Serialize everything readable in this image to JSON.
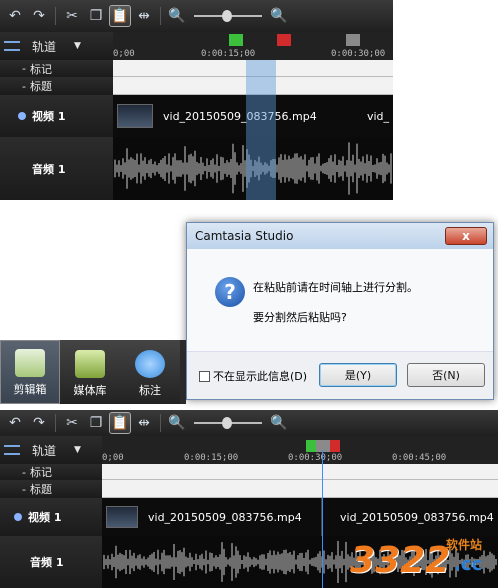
{
  "colors": {
    "marker_green": "#3cbf3c",
    "marker_red": "#d22b2b",
    "marker_gray": "#8a8a8a",
    "playhead": "#3d8bff",
    "selection": "#5b9ad8"
  },
  "top": {
    "tooltip": "粘贴",
    "tracks_label": "轨道",
    "ruler_ticks": [
      "0;00",
      "0:00:15;00",
      "0:00:30;00"
    ],
    "rows": {
      "marker": "标记",
      "title": "标题"
    },
    "video_track": "视频 1",
    "audio_track": "音频 1",
    "clip_name": "vid_20150509_083756.mp4",
    "clip_name_cut": "vid_"
  },
  "dialog": {
    "title": "Camtasia Studio",
    "close": "x",
    "message": "在粘贴前请在时间轴上进行分割。",
    "question": "要分割然后粘贴吗?",
    "checkbox": "不在显示此信息(D)",
    "yes": "是(Y)",
    "no": "否(N)"
  },
  "tabs": [
    {
      "label": "剪辑箱",
      "icon": "clip-bin-icon"
    },
    {
      "label": "媒体库",
      "icon": "library-icon"
    },
    {
      "label": "标注",
      "icon": "callout-icon"
    }
  ],
  "bottom": {
    "tracks_label": "轨道",
    "ruler_ticks": [
      "0;00",
      "0:00:15;00",
      "0:00:30;00",
      "0:00:45;00"
    ],
    "rows": {
      "marker": "标记",
      "title": "标题"
    },
    "video_track": "视频 1",
    "audio_track": "音频 1",
    "clip_name": "vid_20150509_083756.mp4"
  },
  "watermark": {
    "number": "3322",
    "site": "软件站",
    ".cc": ".cc"
  }
}
